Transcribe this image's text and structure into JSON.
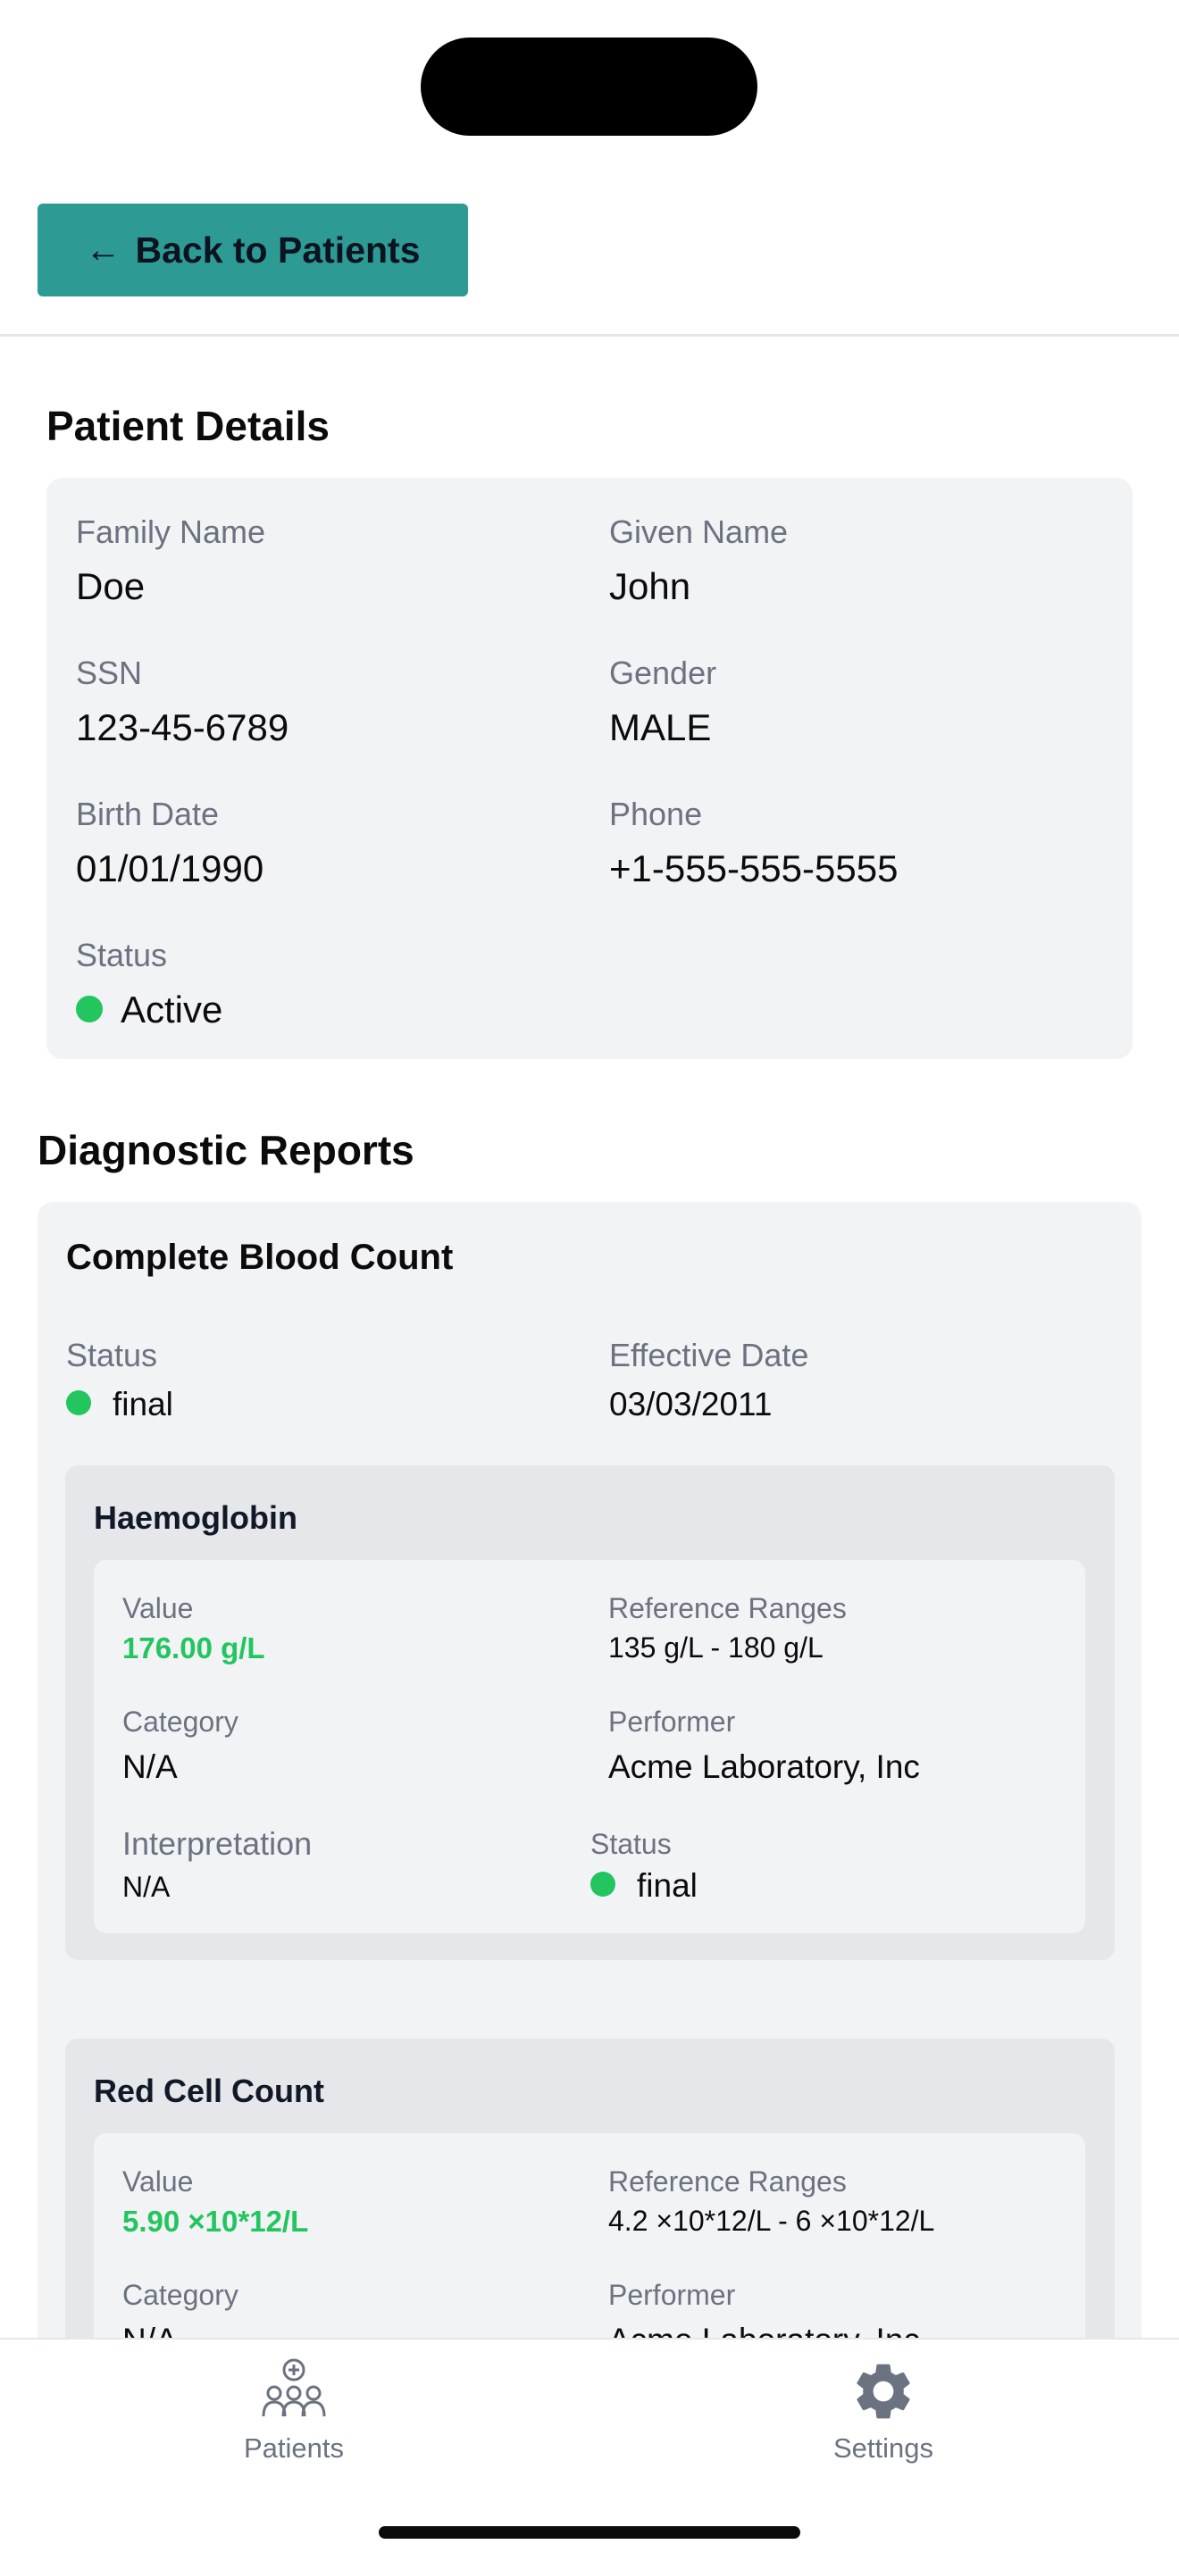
{
  "header": {
    "back_label": "Back to Patients"
  },
  "patient": {
    "section_title": "Patient Details",
    "fields": {
      "family_name": {
        "label": "Family Name",
        "value": "Doe"
      },
      "given_name": {
        "label": "Given Name",
        "value": "John"
      },
      "ssn": {
        "label": "SSN",
        "value": "123-45-6789"
      },
      "gender": {
        "label": "Gender",
        "value": "MALE"
      },
      "birth_date": {
        "label": "Birth Date",
        "value": "01/01/1990"
      },
      "phone": {
        "label": "Phone",
        "value": "+1-555-555-5555"
      },
      "status": {
        "label": "Status",
        "value": "Active"
      }
    }
  },
  "reports": {
    "section_title": "Diagnostic Reports",
    "items": [
      {
        "title": "Complete Blood Count",
        "status_label": "Status",
        "status": "final",
        "date_label": "Effective Date",
        "date": "03/03/2011",
        "observations": [
          {
            "title": "Haemoglobin",
            "value_label": "Value",
            "value": "176.00 g/L",
            "ref_label": "Reference Ranges",
            "ref": "135 g/L - 180 g/L",
            "category_label": "Category",
            "category": "N/A",
            "performer_label": "Performer",
            "performer": "Acme Laboratory, Inc",
            "interpretation_label": "Interpretation",
            "interpretation": "N/A",
            "status_label": "Status",
            "status": "final"
          },
          {
            "title": "Red Cell Count",
            "value_label": "Value",
            "value": "5.90 ×10*12/L",
            "ref_label": "Reference Ranges",
            "ref": "4.2 ×10*12/L - 6 ×10*12/L",
            "category_label": "Category",
            "category": "N/A",
            "performer_label": "Performer",
            "performer": "Acme Laboratory, Inc"
          }
        ]
      }
    ]
  },
  "tabbar": {
    "tabs": [
      {
        "label": "Patients",
        "icon": "patients-icon"
      },
      {
        "label": "Settings",
        "icon": "gear-icon"
      }
    ]
  },
  "colors": {
    "accent": "#2e9a94",
    "status_active": "#22c55e"
  }
}
